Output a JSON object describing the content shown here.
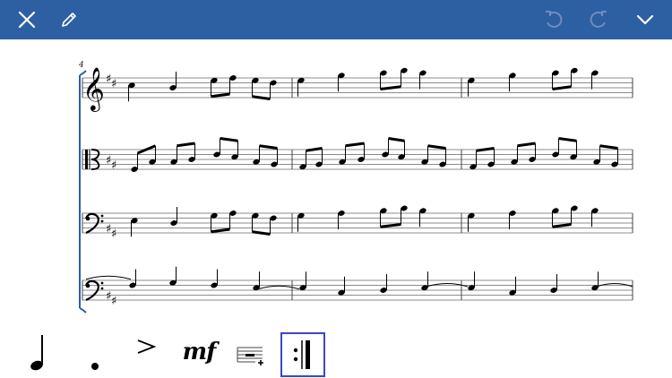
{
  "toolbar": {
    "close_icon": "close-icon",
    "edit_icon": "pencil-icon",
    "undo_icon": "undo-icon",
    "redo_icon": "redo-icon",
    "collapse_icon": "chevron-down-icon",
    "bar_color": "#2d5fa3"
  },
  "score": {
    "measure_number": "4",
    "staves": [
      {
        "clef": "treble",
        "key": "D major (2 sharps)"
      },
      {
        "clef": "alto",
        "key": "D major (2 sharps)"
      },
      {
        "clef": "bass",
        "key": "D major (2 sharps)"
      },
      {
        "clef": "bass",
        "key": "D major (2 sharps)"
      }
    ]
  },
  "palette": {
    "items": [
      {
        "name": "quarter-note-icon"
      },
      {
        "name": "augmentation-dot-icon"
      },
      {
        "name": "accent-icon"
      },
      {
        "name": "dynamic-mf",
        "label": "mf"
      },
      {
        "name": "add-measure-icon"
      },
      {
        "name": "repeat-barline-icon",
        "selected": true
      }
    ],
    "selection_color": "#3a47c9"
  }
}
